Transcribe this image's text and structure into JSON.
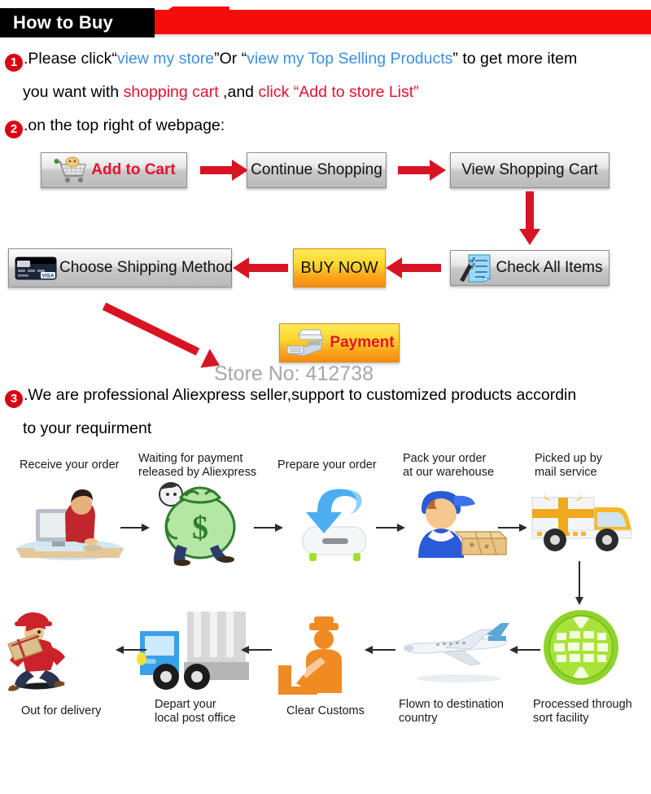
{
  "header": {
    "title": "How to Buy",
    "bar_color": "#f50c0c",
    "tab_color": "#000000"
  },
  "steps": [
    {
      "number": "1",
      "line1_a": ".Please click“",
      "line1_link1": "view my store",
      "line1_b": "”Or “",
      "line1_link2": "view my Top Selling Products",
      "line1_c": "” to get more item",
      "line2_a": "you want with ",
      "line2_red1": "shopping cart",
      "line2_b": " ,and ",
      "line2_red2": "click “Add to store List”"
    },
    {
      "number": "2",
      "line1": ".on the top right of webpage:"
    },
    {
      "number": "3",
      "line1": ".We are professional Aliexpress seller,support to customized products accordin",
      "line2": "to your requirment"
    }
  ],
  "colors": {
    "link_blue": "#3b8ede",
    "accent_red": "#e8112d",
    "arrow_red": "#d81424",
    "badge_red": "#d90012",
    "buy_now_orange": "#fba61b",
    "store_no_gray": "#a7a7a7"
  },
  "flow": {
    "buttons": [
      {
        "id": "add-to-cart",
        "label": "Add to Cart",
        "icon": "shopping-cart-icon",
        "style": "gray",
        "text_color": "red"
      },
      {
        "id": "continue-shopping",
        "label": "Continue Shopping",
        "icon": null,
        "style": "gray",
        "text_color": "black"
      },
      {
        "id": "view-shopping-cart",
        "label": "View Shopping Cart",
        "icon": null,
        "style": "gray",
        "text_color": "black"
      },
      {
        "id": "check-all-items",
        "label": "Check All Items",
        "icon": "checklist-icon",
        "style": "gray",
        "text_color": "black"
      },
      {
        "id": "buy-now",
        "label": "BUY NOW",
        "icon": null,
        "style": "orange",
        "text_color": "black"
      },
      {
        "id": "choose-shipping-method",
        "label": "Choose Shipping Method",
        "icon": "credit-card-icon",
        "style": "gray",
        "text_color": "black"
      },
      {
        "id": "payment",
        "label": "Payment",
        "icon": "cash-register-icon",
        "style": "orange",
        "text_color": "red"
      }
    ],
    "store_no": "Store No: 412738"
  },
  "shipping": {
    "top_row": [
      {
        "label": "Receive your order",
        "icon": "person-at-computer-icon"
      },
      {
        "label": "Waiting for payment\nreleased by Aliexpress",
        "icon": "money-bag-icon"
      },
      {
        "label": "Prepare your order",
        "icon": "download-arrow-icon"
      },
      {
        "label": "Pack your order\nat our warehouse",
        "icon": "warehouse-worker-icon"
      },
      {
        "label": "Picked up by\nmail service",
        "icon": "delivery-truck-icon"
      }
    ],
    "bottom_row": [
      {
        "label": "Out for delivery",
        "icon": "running-courier-icon"
      },
      {
        "label": "Depart your\nlocal post office",
        "icon": "post-truck-icon"
      },
      {
        "label": "Clear Customs",
        "icon": "customs-officer-icon"
      },
      {
        "label": "Flown to destination\ncountry",
        "icon": "airplane-icon"
      },
      {
        "label": "Processed through\nsort facility",
        "icon": "green-globe-icon"
      }
    ]
  }
}
